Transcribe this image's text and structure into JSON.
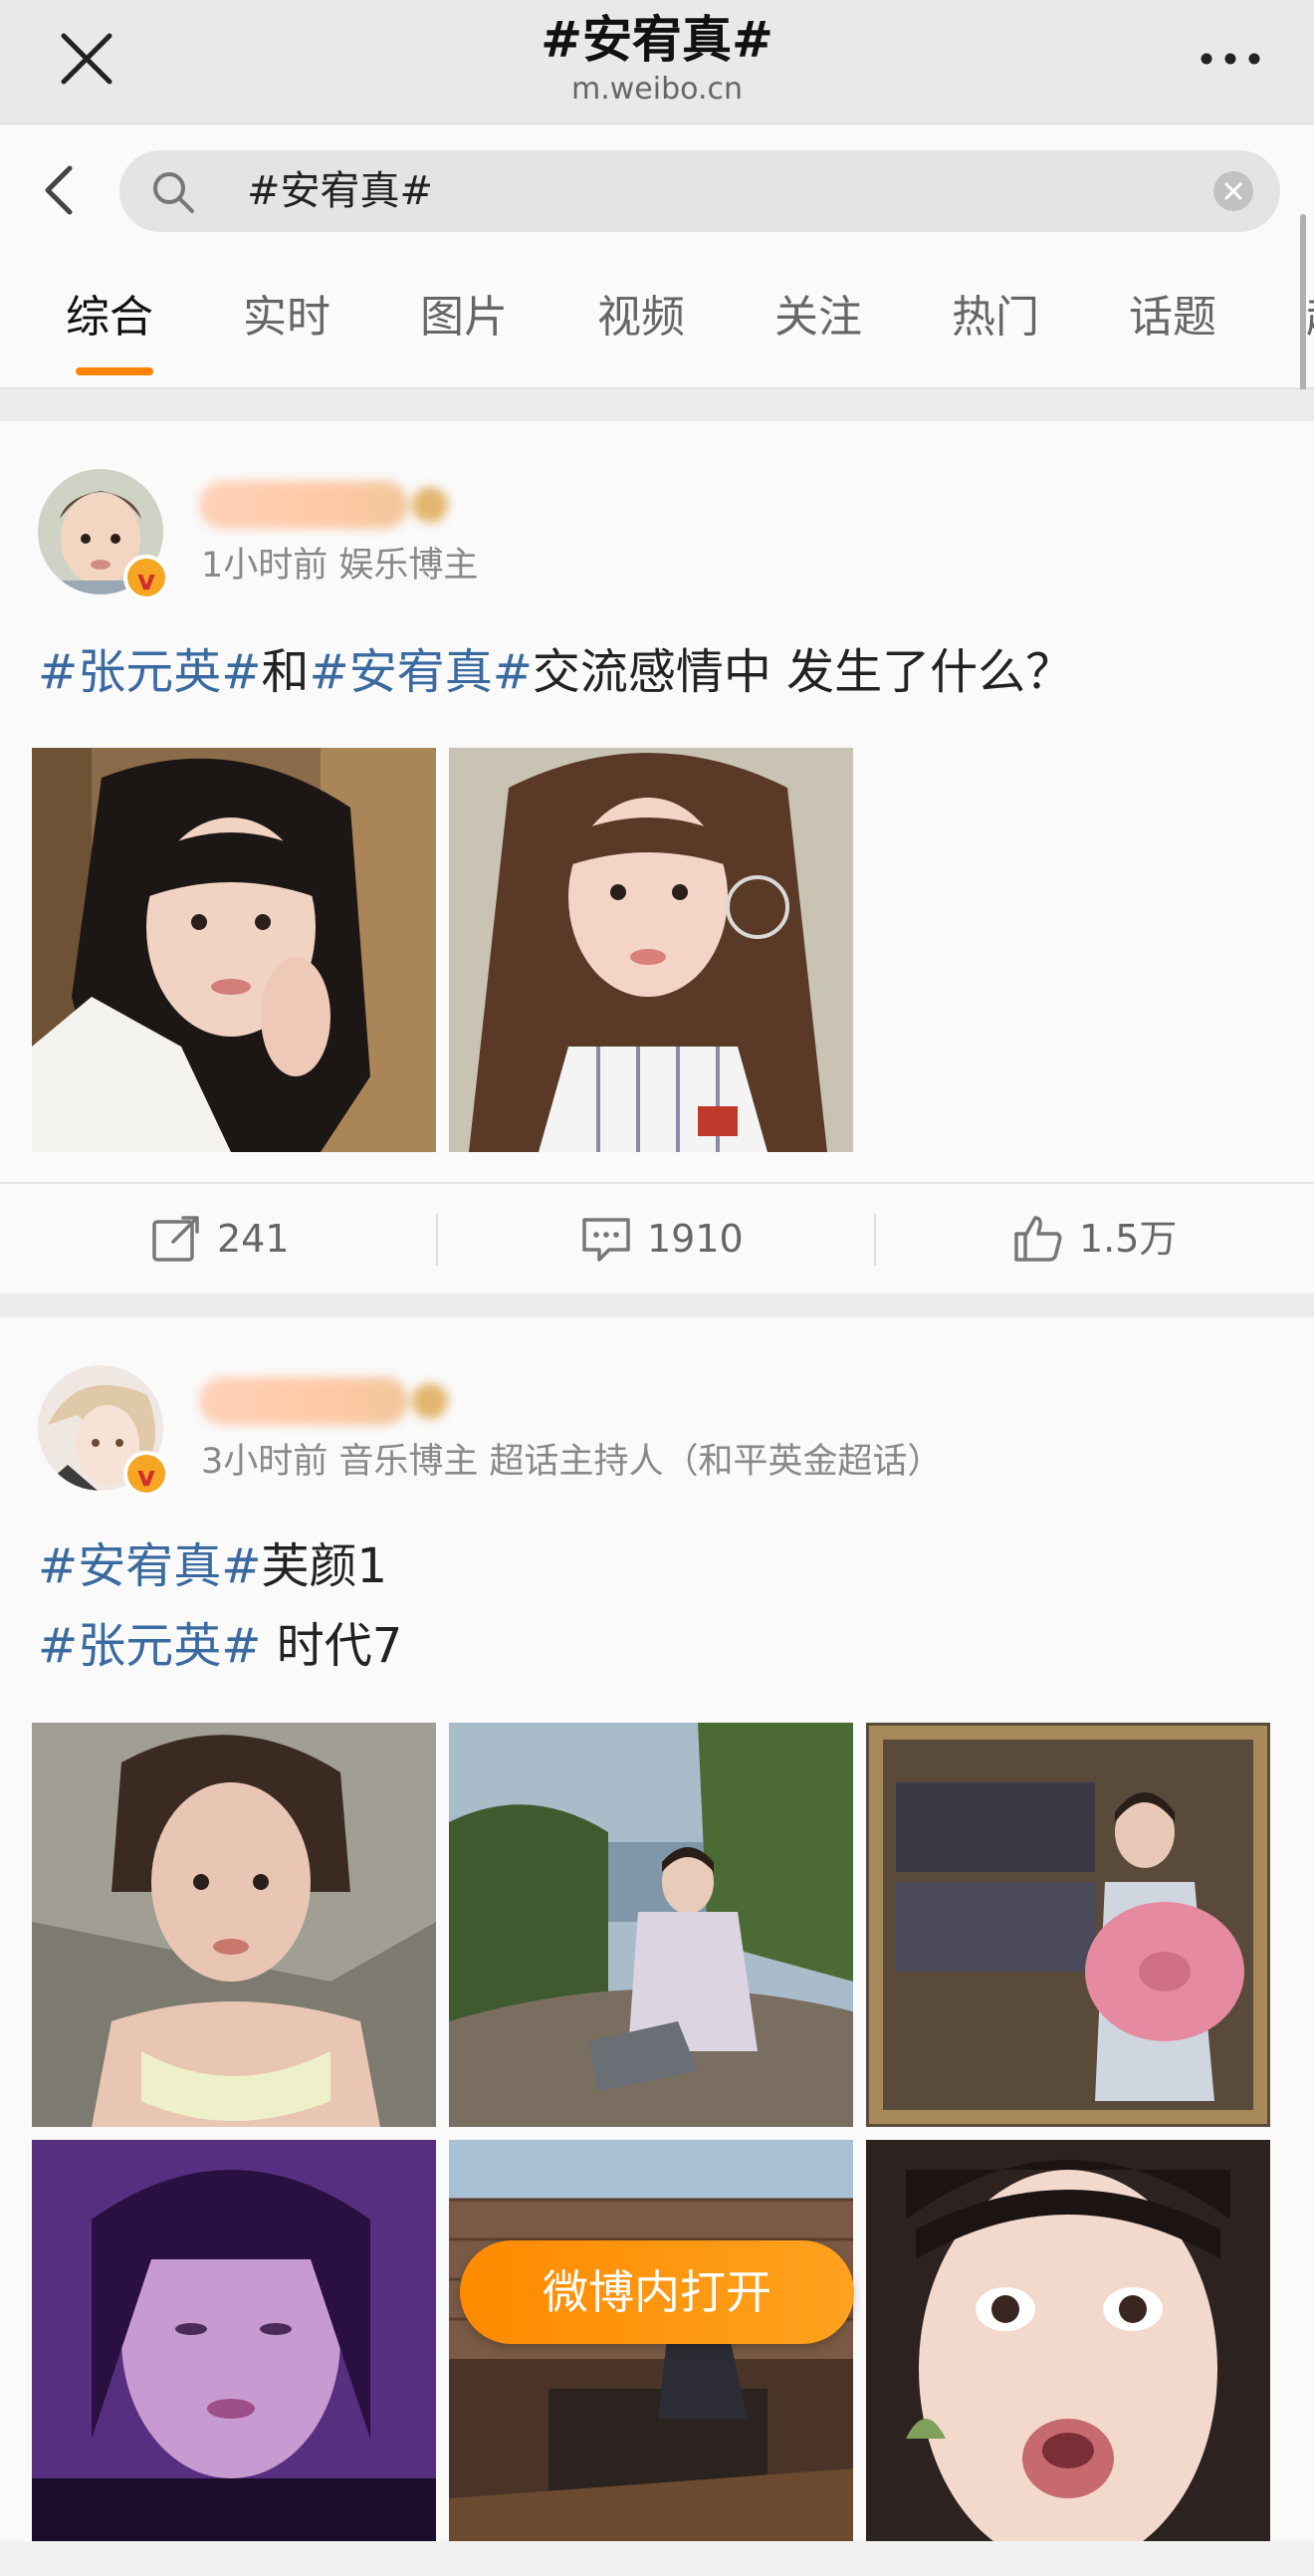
{
  "browser": {
    "title": "#安宥真#",
    "url": "m.weibo.cn"
  },
  "search": {
    "query": "#安宥真#"
  },
  "tabs": [
    {
      "label": "综合",
      "active": true
    },
    {
      "label": "实时"
    },
    {
      "label": "图片"
    },
    {
      "label": "视频"
    },
    {
      "label": "关注"
    },
    {
      "label": "热门"
    },
    {
      "label": "话题"
    },
    {
      "label": "超"
    }
  ],
  "posts": [
    {
      "meta": "1小时前  娱乐博主",
      "text": {
        "tag1": "#张元英#",
        "mid": "和",
        "tag2": "#安宥真#",
        "rest": "交流感情中 发生了什么？"
      },
      "actions": {
        "repost": "241",
        "comment": "1910",
        "like": "1.5万"
      }
    },
    {
      "meta": "3小时前  音乐博主 超话主持人（和平英金超话）",
      "line1": {
        "tag": "#安宥真#",
        "rest": "芙颜1"
      },
      "line2": {
        "tag": "#张元英#",
        "rest": " 时代7"
      }
    }
  ],
  "open_in_app": "微博内打开",
  "colors": {
    "accent": "#ff8200",
    "hashtag": "#3a6aa0"
  }
}
